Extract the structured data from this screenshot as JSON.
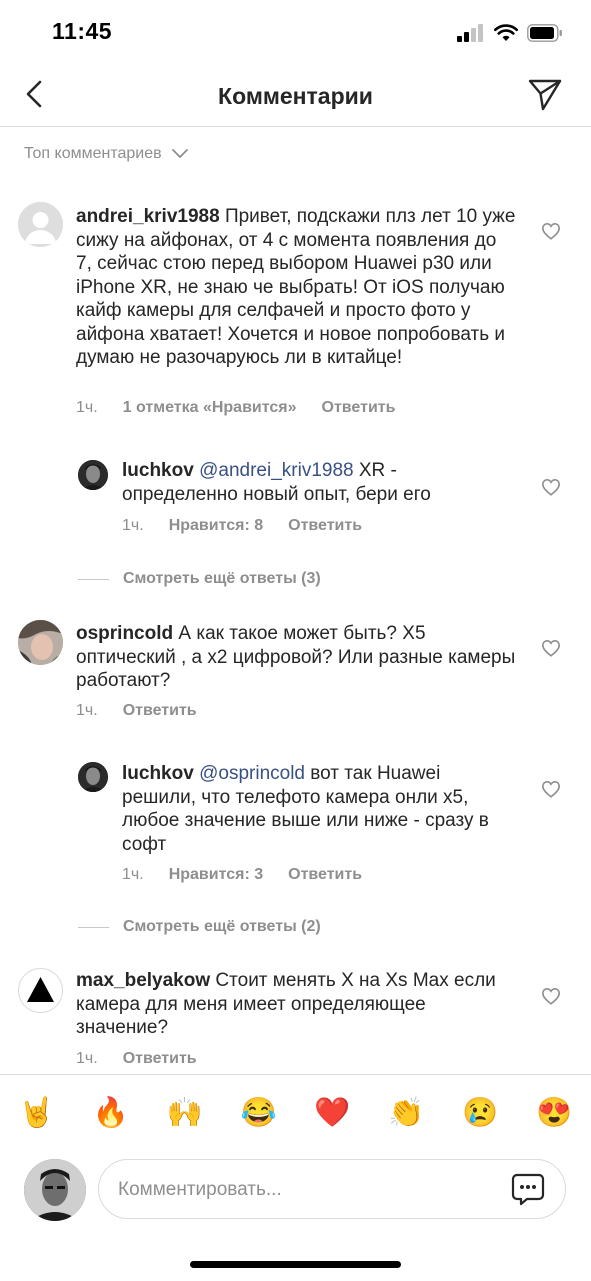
{
  "status_bar": {
    "time": "11:45"
  },
  "header": {
    "title": "Комментарии"
  },
  "sort": {
    "label": "Топ комментариев"
  },
  "comments": [
    {
      "username": "andrei_kriv1988",
      "text": "Привет, подскажи плз лет 10 уже сижу на айфонах, от 4 с момента появления до 7, сейчас стою перед выбором Huawei p30 или iPhone XR, не знаю че выбрать! От iOS получаю кайф камеры для селфачей и просто фото у айфона хватает! Хочется и новое попробовать и думаю не разочаруюсь ли в китайце!",
      "time": "1ч.",
      "likes": "1 отметка «Нравится»",
      "reply": "Ответить",
      "replies": [
        {
          "username": "luchkov",
          "mention": "@andrei_kriv1988",
          "text": "XR - определенно новый опыт, бери его",
          "time": "1ч.",
          "likes": "Нравится: 8",
          "reply": "Ответить"
        }
      ],
      "more_replies": "Смотреть ещё ответы (3)"
    },
    {
      "username": "osprincold",
      "text": "А как такое может быть? Х5 оптический , а х2 цифровой? Или разные камеры работают?",
      "time": "1ч.",
      "reply": "Ответить",
      "replies": [
        {
          "username": "luchkov",
          "mention": "@osprincold",
          "text": "вот так Huawei решили, что телефото камера онли х5, любое значение выше или ниже - сразу в софт",
          "time": "1ч.",
          "likes": "Нравится: 3",
          "reply": "Ответить"
        }
      ],
      "more_replies": "Смотреть ещё ответы (2)"
    },
    {
      "username": "max_belyakow",
      "text": "Стоит менять Х на Xs Max если камера для меня имеет определяющее значение?",
      "time": "1ч.",
      "reply": "Ответить"
    }
  ],
  "emoji_bar": [
    "🤘",
    "🔥",
    "🙌",
    "😂",
    "❤️",
    "👏",
    "😢",
    "😍"
  ],
  "composer": {
    "placeholder": "Комментировать..."
  },
  "colors": {
    "text": "#262626",
    "secondary": "#8e8e8e",
    "mention": "#385185",
    "divider": "#dbdbdb"
  }
}
